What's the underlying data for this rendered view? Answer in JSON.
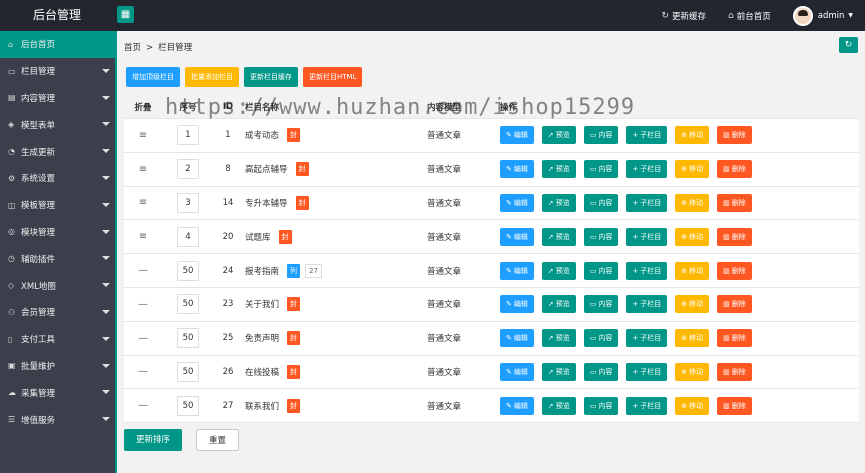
{
  "header": {
    "logo": "后台管理",
    "toggle_icon": "▦",
    "nav": [
      {
        "icon": "↻",
        "label": "更新缓存"
      },
      {
        "icon": "⌂",
        "label": "前台首页"
      }
    ],
    "user": "admin"
  },
  "sidebar": {
    "items": [
      {
        "icon": "⌂",
        "label": "后台首页",
        "active": true,
        "has_arrow": false
      },
      {
        "icon": "▭",
        "label": "栏目管理",
        "has_arrow": true
      },
      {
        "icon": "▤",
        "label": "内容管理",
        "has_arrow": true
      },
      {
        "icon": "◈",
        "label": "模型表单",
        "has_arrow": true
      },
      {
        "icon": "◔",
        "label": "生成更新",
        "has_arrow": true
      },
      {
        "icon": "⚙",
        "label": "系统设置",
        "has_arrow": true
      },
      {
        "icon": "◫",
        "label": "模板管理",
        "has_arrow": true
      },
      {
        "icon": "◎",
        "label": "模块管理",
        "has_arrow": true
      },
      {
        "icon": "◷",
        "label": "辅助插件",
        "has_arrow": true
      },
      {
        "icon": "◇",
        "label": "XML地图",
        "has_arrow": true
      },
      {
        "icon": "⚇",
        "label": "会员管理",
        "has_arrow": true
      },
      {
        "icon": "▯",
        "label": "支付工具",
        "has_arrow": true
      },
      {
        "icon": "▣",
        "label": "批量维护",
        "has_arrow": true
      },
      {
        "icon": "☁",
        "label": "采集管理",
        "has_arrow": true
      },
      {
        "icon": "☰",
        "label": "增值服务",
        "has_arrow": true
      }
    ]
  },
  "breadcrumb": {
    "home": "首页",
    "sep": ">",
    "current": "栏目管理"
  },
  "refresh_icon": "↻",
  "toolbar": {
    "buttons": [
      {
        "label": "增加顶级栏目",
        "color": "blue"
      },
      {
        "label": "批量添加栏目",
        "color": "yellow"
      },
      {
        "label": "更新栏目缓存",
        "color": "green"
      },
      {
        "label": "更新栏目HTML",
        "color": "red"
      }
    ]
  },
  "watermark": "https://www.huzhan.com/ishop15299",
  "table": {
    "headers": [
      "折叠",
      "序号",
      "ID",
      "栏目名称",
      "内容模型",
      "操作"
    ],
    "rows": [
      {
        "fold": "≡",
        "order": "1",
        "id": "1",
        "name": "成考动态",
        "tag": "封",
        "tag_type": "red",
        "count": "",
        "model": "普通文章"
      },
      {
        "fold": "≡",
        "order": "2",
        "id": "8",
        "name": "高起点辅导",
        "tag": "封",
        "tag_type": "red",
        "count": "",
        "model": "普通文章"
      },
      {
        "fold": "≡",
        "order": "3",
        "id": "14",
        "name": "专升本辅导",
        "tag": "封",
        "tag_type": "red",
        "count": "",
        "model": "普通文章"
      },
      {
        "fold": "≡",
        "order": "4",
        "id": "20",
        "name": "试题库",
        "tag": "封",
        "tag_type": "red",
        "count": "",
        "model": "普通文章"
      },
      {
        "fold": "—",
        "order": "50",
        "id": "24",
        "name": "报考指南",
        "tag": "列",
        "tag_type": "blue",
        "count": "27",
        "model": "普通文章"
      },
      {
        "fold": "—",
        "order": "50",
        "id": "23",
        "name": "关于我们",
        "tag": "封",
        "tag_type": "red",
        "count": "",
        "model": "普通文章"
      },
      {
        "fold": "—",
        "order": "50",
        "id": "25",
        "name": "免责声明",
        "tag": "封",
        "tag_type": "red",
        "count": "",
        "model": "普通文章"
      },
      {
        "fold": "—",
        "order": "50",
        "id": "26",
        "name": "在线投稿",
        "tag": "封",
        "tag_type": "red",
        "count": "",
        "model": "普通文章"
      },
      {
        "fold": "—",
        "order": "50",
        "id": "27",
        "name": "联系我们",
        "tag": "封",
        "tag_type": "red",
        "count": "",
        "model": "普通文章"
      }
    ],
    "operations": [
      {
        "icon": "✎",
        "label": "编辑",
        "color": "blue",
        "name": "edit"
      },
      {
        "icon": "➚",
        "label": "预览",
        "color": "green",
        "name": "preview"
      },
      {
        "icon": "▭",
        "label": "内容",
        "color": "green",
        "name": "content"
      },
      {
        "icon": "+",
        "label": "子栏目",
        "color": "green",
        "name": "subcategory"
      },
      {
        "icon": "⊕",
        "label": "移动",
        "color": "yellow",
        "name": "move"
      },
      {
        "icon": "▥",
        "label": "删除",
        "color": "red",
        "name": "delete"
      }
    ]
  },
  "footer": {
    "update_sort": "更新排序",
    "reset": "重置"
  }
}
